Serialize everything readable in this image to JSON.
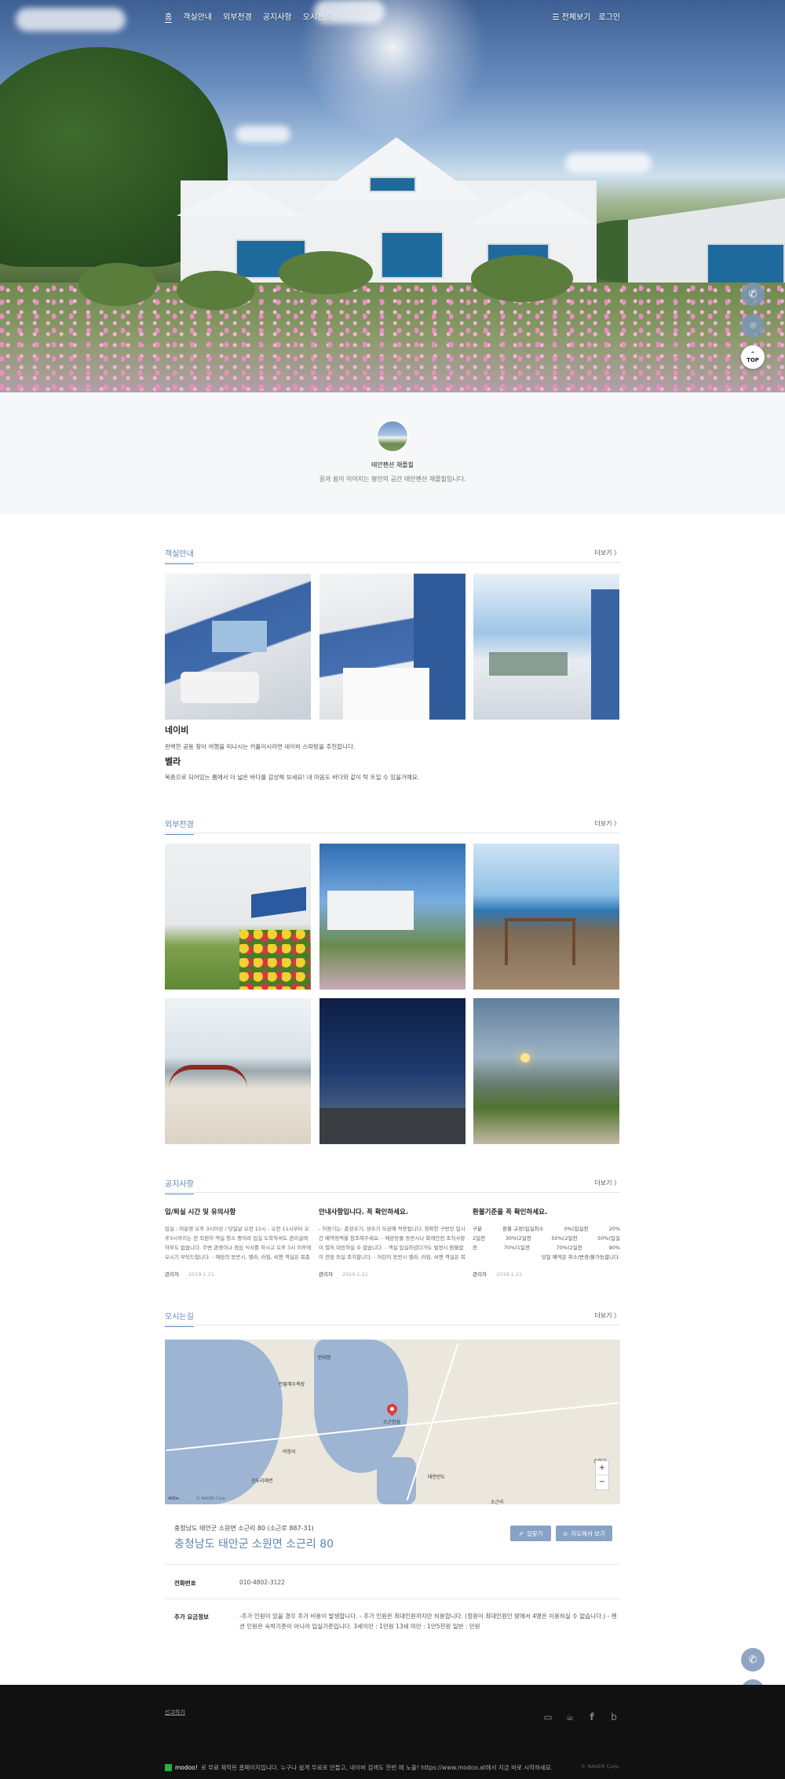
{
  "nav": {
    "menu": [
      "홈",
      "객실안내",
      "외부전경",
      "공지사항",
      "오시는길"
    ],
    "all_menu": "☰ 전체보기",
    "login": "로그인"
  },
  "floating": {
    "top_label": "TOP"
  },
  "profile": {
    "name": "태안펜션 채플힐",
    "desc": "꿈과 쉼이 이어지는 평안의 공간 태안펜션 채플힐입니다."
  },
  "rooms": {
    "title": "객실안내",
    "more": "더보기 〉",
    "items": [
      {
        "name": "네이비",
        "desc": "완벽한 공동 찾아 여행을 떠나시는 커플이시라면 네이비 스파방을 추천합니다."
      },
      {
        "name": "벨라",
        "desc": "복층으로 되어있는 룸에서 더 넓은 바다를 감상해 보세요! 내 마음도 바다와 같이 탁 트일 수 있을거예요."
      }
    ]
  },
  "exterior": {
    "title": "외부전경",
    "more": "더보기 〉"
  },
  "notices": {
    "title": "공지사항",
    "more": "더보기 〉",
    "items": [
      {
        "title": "입/퇴실 시간 및 유의사항",
        "body": "입실 : 미운영 오후 3시이상 / 당일날 오전 11시 - 오전 11시부터 오후3시까지는 전 직원이 객실 청소 중이라 입실 도착하셔도 관리실에 아무도 없습니다. 주변 관광이나 점심 식사를 하시고 오후 3시 이후에 오시기 부탁드립니다. - 애완의 동반시, 벨라, 라임, 씨엔 객실은 복층 계단을 조심해주세요.",
        "author": "관리자",
        "date": "2019.1.21"
      },
      {
        "title": "안내사항입니다. 꼭 확인하세요.",
        "body": "- 허용기는: 준성수기, 성수기 모금에 적용됩니다. 정확한 구방인 입시간 예약정액을 참조해주세요. - 애완동물 동반시나 화재안전 조치사항이 철저 대응하실 수 없습니다. - 객실 입실하셨다가도 벌연시 환불없이 전원 퇴실 조치합니다. - 어린이 동반시 벨라, 라임, 씨엔 객실은 복층 계단을 조심해주세요.",
        "author": "관리자",
        "date": "2019.1.21"
      },
      {
        "title": "환불기준을 꼭 확인하세요.",
        "rows": [
          [
            "구분",
            "환불 규정(입실최소",
            "0%(입실전",
            "20%"
          ],
          [
            "2일전",
            "30%(2일전",
            "50%(2일전",
            "50%(입실"
          ],
          [
            "전",
            "70%(1일전",
            "70%(2일전",
            "90%"
          ]
        ],
        "tail": "당일 예약은 취소/변경/불가능합니다.",
        "author": "관리자",
        "date": "2019.1.21"
      }
    ]
  },
  "location": {
    "title": "오시는길",
    "more": "더보기 〉",
    "map_labels": {
      "pin": "소근진성",
      "area1": "의항리",
      "area2": "태안반도",
      "area3": "송현리",
      "area4": "소근리",
      "place1": "만대항",
      "place2": "안흥해수욕장",
      "place3": "신두리해변",
      "scale": "400m",
      "credit": "© NAVER Corp."
    },
    "zoom_in": "+",
    "zoom_out": "−",
    "address_small": "충청남도 태안군 소원면 소근리 80 (소근로 887-31)",
    "address_big": "충청남도 태안군 소원면 소근리 80",
    "btn_directions": "길찾기",
    "btn_map": "지도에서 보기",
    "phone_label": "전화번호",
    "phone": "010-4802-3122",
    "fee_label": "추가 요금정보",
    "fee": "-추가 인원이 있을 경우 추가 비용이 발생합니다. - 추가 인원은 최대인원까지만 허용합니다. (정원이 최대인원인 방에서 4명은 이용하실 수 없습니다.) - 펜션 인원은 숙박기준이 아니라 입실기준입니다. 3세이만 : 1만원 13세 미만 : 1만5천원 일반 : 만원"
  },
  "footer": {
    "report": "신고하기",
    "social_icons": [
      "talk-icon",
      "cafe-icon",
      "facebook-icon",
      "blog-icon"
    ],
    "bottom_text": "로 무료 제작된 홈페이지입니다. 누구나 쉽게 무료로 만들고, 네이버 검색도 한번 에 노출! https://www.modoo.at에서 지금 바로 시작하세요.",
    "brand": "modoo!",
    "copyright": "© NAVER Corp."
  }
}
